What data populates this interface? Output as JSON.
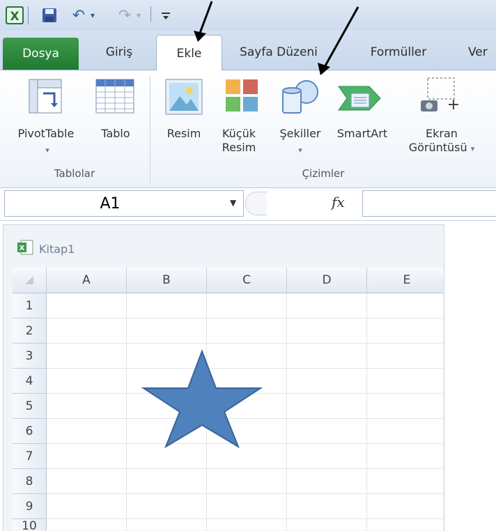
{
  "quick_access": {
    "undo": "↶",
    "redo": "↷",
    "customize": "▾"
  },
  "tabs": {
    "file": "Dosya",
    "home": "Giriş",
    "insert": "Ekle",
    "page_layout": "Sayfa Düzeni",
    "formulas": "Formüller",
    "data_partial": "Ver"
  },
  "ribbon": {
    "groups": {
      "tables": "Tablolar",
      "illustrations": "Çizimler"
    },
    "commands": {
      "pivot_table": "PivotTable",
      "table": "Tablo",
      "picture": "Resim",
      "clip_art_line1": "Küçük",
      "clip_art_line2": "Resim",
      "shapes": "Şekiller",
      "smartart": "SmartArt",
      "screenshot_line1": "Ekran",
      "screenshot_line2": "Görüntüsü",
      "dropdown_marker": "▾"
    }
  },
  "formula_bar": {
    "name_box": "A1",
    "fx": "fx",
    "formula": ""
  },
  "workbook": {
    "title": "Kitap1",
    "columns": [
      "A",
      "B",
      "C",
      "D",
      "E"
    ],
    "rows": [
      "1",
      "2",
      "3",
      "4",
      "5",
      "6",
      "7",
      "8",
      "9",
      "10"
    ]
  },
  "shape": {
    "type": "star",
    "fill": "#4f81bd",
    "stroke": "#3a6496"
  },
  "annotations": {
    "arrow_color": "#000000"
  }
}
